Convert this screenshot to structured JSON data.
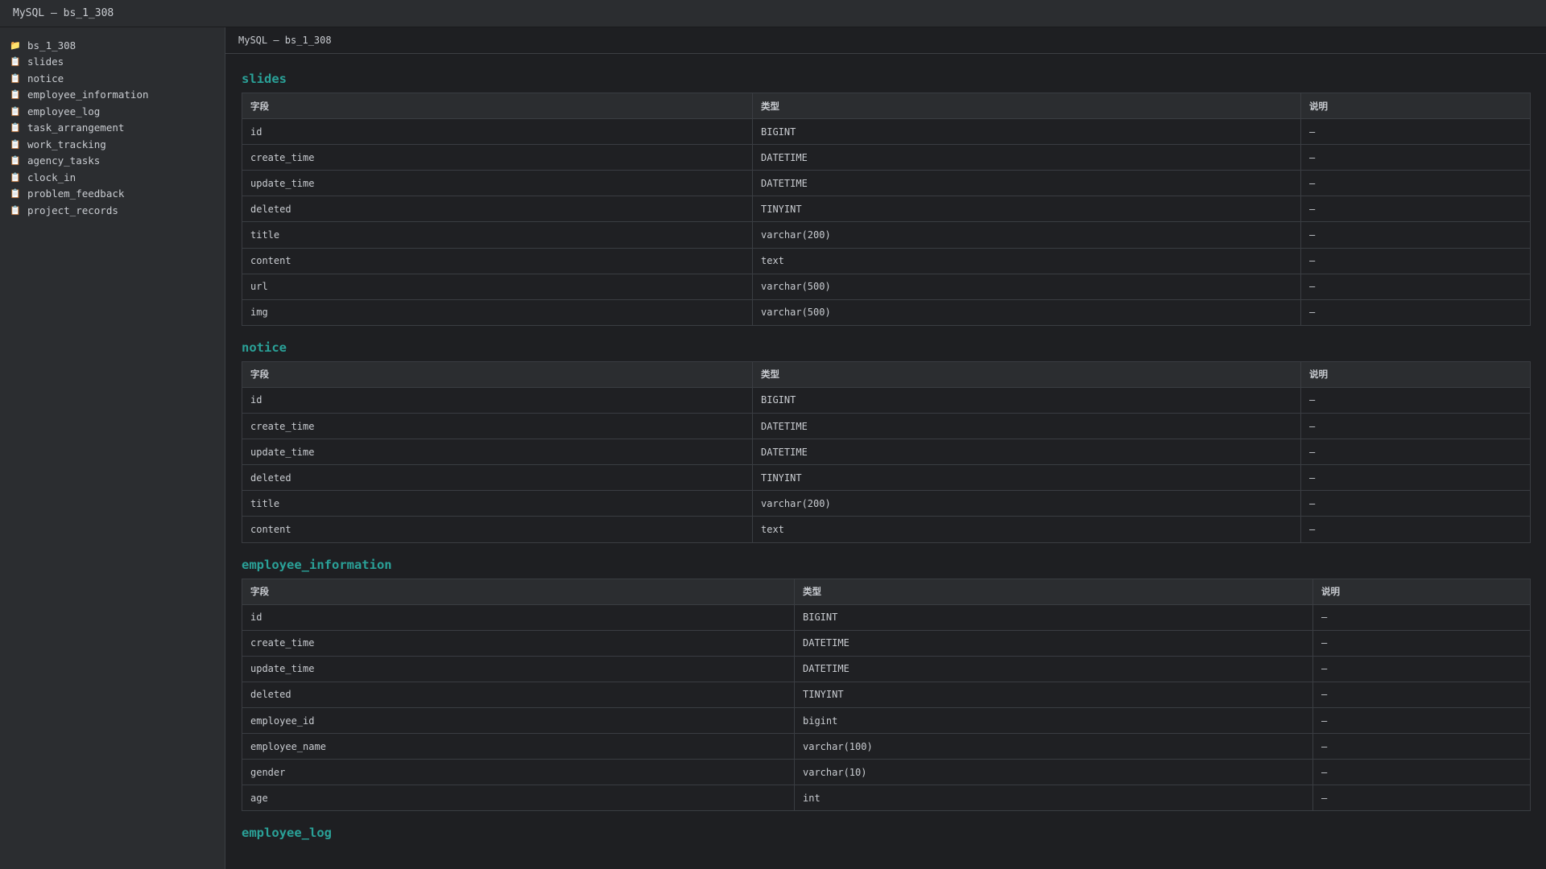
{
  "window": {
    "title": "MySQL — bs_1_308"
  },
  "sidebar": {
    "root": {
      "icon": "folder-icon",
      "label": "bs_1_308"
    },
    "items": [
      {
        "icon": "table-icon",
        "label": "slides"
      },
      {
        "icon": "table-icon",
        "label": "notice"
      },
      {
        "icon": "table-icon",
        "label": "employee_information"
      },
      {
        "icon": "table-icon",
        "label": "employee_log"
      },
      {
        "icon": "table-icon",
        "label": "task_arrangement"
      },
      {
        "icon": "table-icon",
        "label": "work_tracking"
      },
      {
        "icon": "table-icon",
        "label": "agency_tasks"
      },
      {
        "icon": "table-icon",
        "label": "clock_in"
      },
      {
        "icon": "table-icon",
        "label": "problem_feedback"
      },
      {
        "icon": "table-icon",
        "label": "project_records"
      }
    ]
  },
  "breadcrumb": "MySQL — bs_1_308",
  "columns": {
    "field": "字段",
    "type": "类型",
    "desc": "说明"
  },
  "tables": {
    "slides": {
      "name": "slides",
      "rows": [
        {
          "field": "id",
          "type": "BIGINT",
          "desc": "—"
        },
        {
          "field": "create_time",
          "type": "DATETIME",
          "desc": "—"
        },
        {
          "field": "update_time",
          "type": "DATETIME",
          "desc": "—"
        },
        {
          "field": "deleted",
          "type": "TINYINT",
          "desc": "—"
        },
        {
          "field": "title",
          "type": "varchar(200)",
          "desc": "—"
        },
        {
          "field": "content",
          "type": "text",
          "desc": "—"
        },
        {
          "field": "url",
          "type": "varchar(500)",
          "desc": "—"
        },
        {
          "field": "img",
          "type": "varchar(500)",
          "desc": "—"
        }
      ]
    },
    "notice": {
      "name": "notice",
      "rows": [
        {
          "field": "id",
          "type": "BIGINT",
          "desc": "—"
        },
        {
          "field": "create_time",
          "type": "DATETIME",
          "desc": "—"
        },
        {
          "field": "update_time",
          "type": "DATETIME",
          "desc": "—"
        },
        {
          "field": "deleted",
          "type": "TINYINT",
          "desc": "—"
        },
        {
          "field": "title",
          "type": "varchar(200)",
          "desc": "—"
        },
        {
          "field": "content",
          "type": "text",
          "desc": "—"
        }
      ]
    },
    "employee_information": {
      "name": "employee_information",
      "rows": [
        {
          "field": "id",
          "type": "BIGINT",
          "desc": "—"
        },
        {
          "field": "create_time",
          "type": "DATETIME",
          "desc": "—"
        },
        {
          "field": "update_time",
          "type": "DATETIME",
          "desc": "—"
        },
        {
          "field": "deleted",
          "type": "TINYINT",
          "desc": "—"
        },
        {
          "field": "employee_id",
          "type": "bigint",
          "desc": "—"
        },
        {
          "field": "employee_name",
          "type": "varchar(100)",
          "desc": "—"
        },
        {
          "field": "gender",
          "type": "varchar(10)",
          "desc": "—"
        },
        {
          "field": "age",
          "type": "int",
          "desc": "—"
        }
      ]
    },
    "employee_log": {
      "name": "employee_log"
    }
  },
  "colors": {
    "accent": "#2aa198",
    "background": "#1e1f22",
    "panel": "#2b2d30"
  }
}
